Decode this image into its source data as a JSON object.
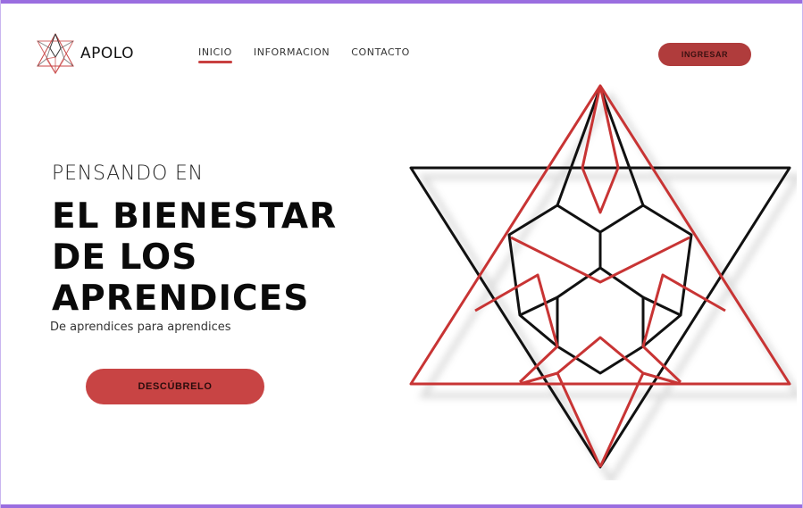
{
  "brand": {
    "name": "APOLO",
    "logo_icon": "star-tetrahedron-logo-icon"
  },
  "nav": {
    "items": [
      {
        "label": "INICIO",
        "active": true
      },
      {
        "label": "INFORMACION",
        "active": false
      },
      {
        "label": "CONTACTO",
        "active": false
      }
    ]
  },
  "header": {
    "login_label": "INGRESAR"
  },
  "hero": {
    "pre_title": "PENSANDO EN",
    "title_lines": [
      "EL BIENESTAR",
      "DE LOS",
      "APRENDICES"
    ],
    "subtitle": "De aprendices para aprendices",
    "cta_label": "DESCÚBRELO"
  },
  "art": {
    "icon": "star-tetrahedron-illustration"
  },
  "colors": {
    "accent": "#c84444",
    "accent_dark": "#b03c3c",
    "frame": "#9a6ee0",
    "text": "#0a0a0a"
  }
}
